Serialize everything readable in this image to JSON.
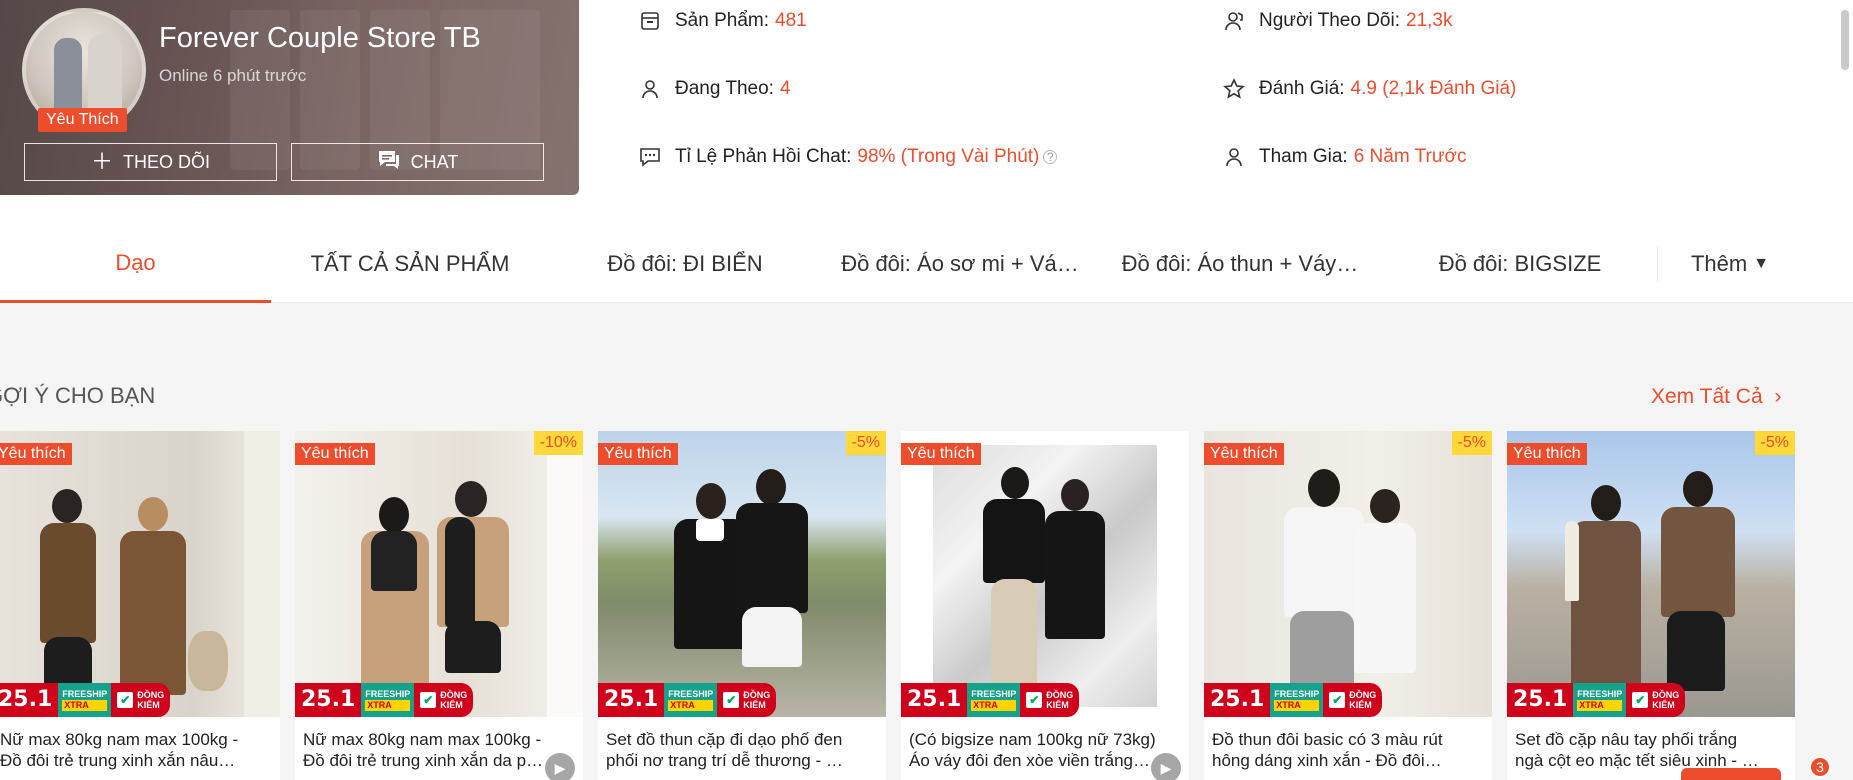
{
  "shop": {
    "name": "Forever Couple Store TB",
    "online": "Online 6 phút trước",
    "badge": "Yêu Thích",
    "follow_label": "THEO DÕI",
    "chat_label": "CHAT"
  },
  "stats": {
    "products_label": "Sản Phẩm:",
    "products_value": "481",
    "following_label": "Đang Theo:",
    "following_value": "4",
    "response_label": "Tỉ Lệ Phản Hồi Chat:",
    "response_value": "98% (Trong Vài Phút)",
    "followers_label": "Người Theo Dõi:",
    "followers_value": "21,3k",
    "rating_label": "Đánh Giá:",
    "rating_value": "4.9 (2,1k Đánh Giá)",
    "joined_label": "Tham Gia:",
    "joined_value": "6 Năm Trước"
  },
  "tabs": [
    {
      "label": "Dạo"
    },
    {
      "label": "TẤT CẢ SẢN PHẨM"
    },
    {
      "label": "Đồ đôi: ĐI BIỂN"
    },
    {
      "label": "Đồ đôi: Áo sơ mi + Vá…"
    },
    {
      "label": "Đồ đôi: Áo thun + Váy…"
    },
    {
      "label": "Đồ đôi: BIGSIZE"
    },
    {
      "label": "Thêm"
    }
  ],
  "section": {
    "title": "GỢI Ý CHO BẠN",
    "see_all": "Xem Tất Cả"
  },
  "promo": {
    "sale": "25.1",
    "freeship": "FREESHIP",
    "xtra": "XTRA",
    "dong": "ĐỒNG",
    "kiem": "KIỂM"
  },
  "products": [
    {
      "badge": "Yêu thích",
      "discount": "",
      "line1": "Nữ max 80kg nam max 100kg -",
      "line2": "Đồ đôi trẻ trung xinh xắn nâu…"
    },
    {
      "badge": "Yêu thích",
      "discount": "-10%",
      "line1": "Nữ max 80kg nam max 100kg -",
      "line2": "Đồ đôi trẻ trung xinh xắn da p…"
    },
    {
      "badge": "Yêu thích",
      "discount": "-5%",
      "line1": "Set đồ thun cặp đi dạo phố đen",
      "line2": "phối nơ trang trí dễ thương - …"
    },
    {
      "badge": "Yêu thích",
      "discount": "",
      "line1": "(Có bigsize nam 100kg nữ 73kg)",
      "line2": "Áo váy đôi đen xòe viền trắng…"
    },
    {
      "badge": "Yêu thích",
      "discount": "-5%",
      "line1": "Đồ thun đôi basic có 3 màu rút",
      "line2": "hông dáng xinh xắn - Đồ đôi…"
    },
    {
      "badge": "Yêu thích",
      "discount": "-5%",
      "line1": "Set đồ cặp nâu tay phối trắng",
      "line2": "ngà cột eo mặc tết siêu xinh - …"
    }
  ],
  "cart_count": "3",
  "colors": {
    "accent": "#ee4d2d",
    "badge_yellow": "#ffd839"
  }
}
